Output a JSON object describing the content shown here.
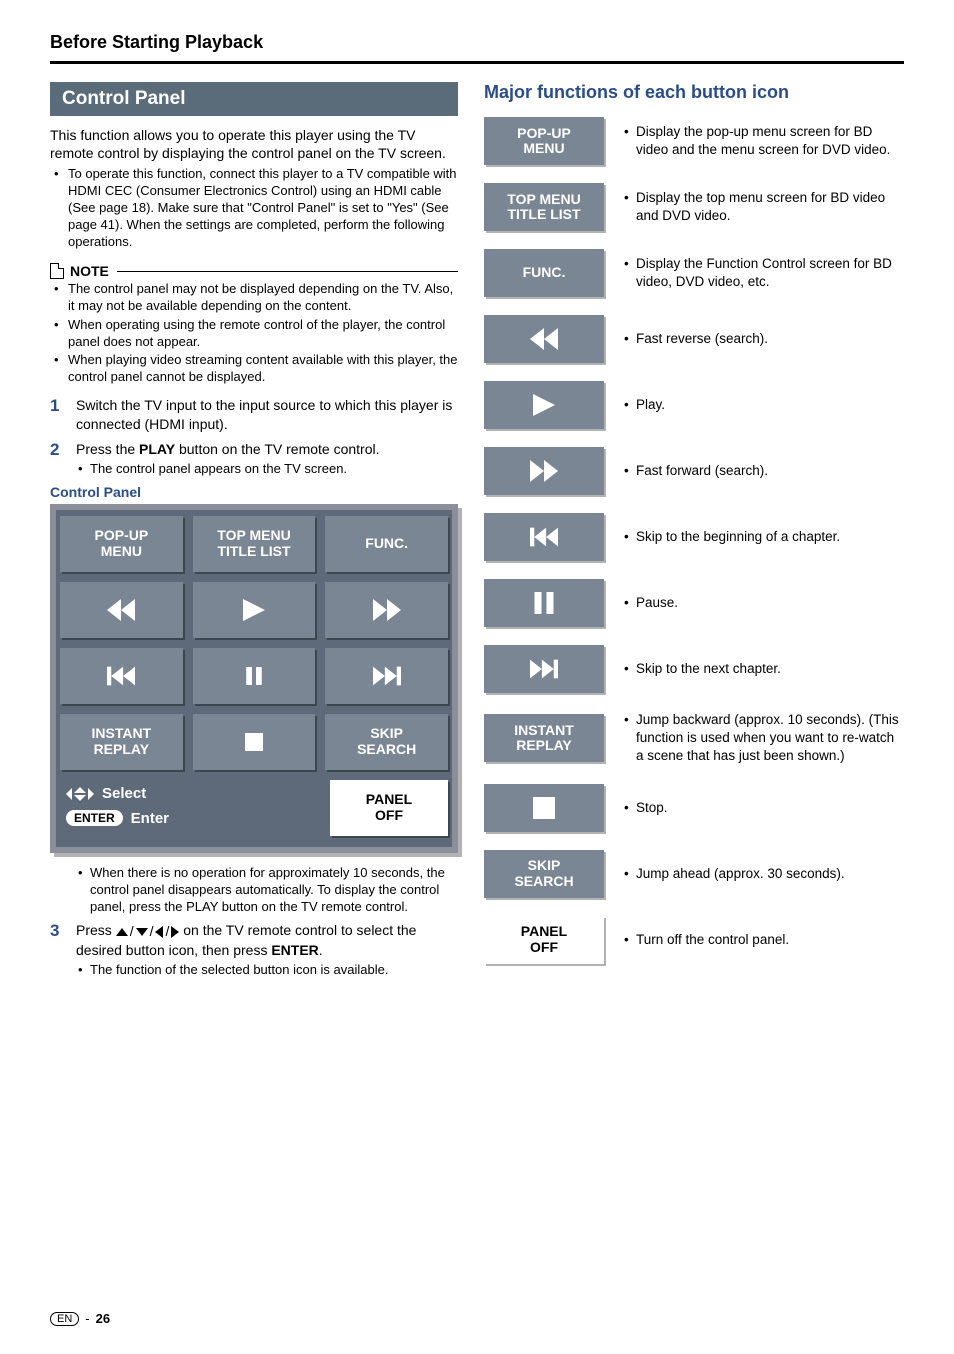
{
  "header": {
    "title": "Before Starting Playback"
  },
  "left": {
    "section_title": "Control Panel",
    "intro": "This function allows you to operate this player using the TV remote control by displaying the control panel on the TV screen.",
    "intro_bullets": [
      "To operate this function, connect this player to a TV compatible with HDMI CEC (Consumer Electronics Control) using an HDMI cable (See page 18). Make sure that \"Control Panel\" is set to \"Yes\" (See page 41). When the settings are completed, perform the following operations."
    ],
    "note_label": "NOTE",
    "note_bullets": [
      "The control panel may not be displayed depending on the TV. Also, it may not be available depending on the content.",
      "When operating using the remote control of the player, the control panel does not appear.",
      "When playing video streaming content available with this player, the control panel cannot be displayed."
    ],
    "steps": [
      {
        "num": "1",
        "body": "Switch the TV input to the input source to which this player is connected (HDMI input).",
        "sub": []
      },
      {
        "num": "2",
        "body_pre": "Press the ",
        "body_bold": "PLAY",
        "body_post": " button on the TV remote control.",
        "sub": [
          "The control panel appears on the TV screen."
        ]
      }
    ],
    "cp_caption": "Control Panel",
    "panel_labels": {
      "popup_a": "POP-UP",
      "popup_b": "MENU",
      "topmenu_a": "TOP MENU",
      "topmenu_b": "TITLE LIST",
      "func": "FUNC.",
      "instant_a": "INSTANT",
      "instant_b": "REPLAY",
      "skip_a": "SKIP",
      "skip_b": "SEARCH",
      "paneloff_a": "PANEL",
      "paneloff_b": "OFF",
      "select": "Select",
      "enter_badge": "ENTER",
      "enter": "Enter"
    },
    "after_panel_bullets": [
      "When there is no operation for approximately 10 seconds, the control panel disappears automatically. To display the control panel, press the PLAY button on the TV remote control."
    ],
    "step3": {
      "num": "3",
      "body_pre": "Press ",
      "body_mid": " on the TV remote control to select the desired button icon, then press ",
      "body_bold2": "ENTER",
      "body_end": ".",
      "sub": [
        "The function of the selected button icon is available."
      ]
    }
  },
  "right": {
    "title": "Major functions of each button icon",
    "items": [
      {
        "label_a": "POP-UP",
        "label_b": "MENU",
        "icon": "",
        "desc": "Display the pop-up menu screen for BD video and the menu screen for DVD video."
      },
      {
        "label_a": "TOP MENU",
        "label_b": "TITLE LIST",
        "icon": "",
        "desc": "Display the top menu screen for BD video and DVD video."
      },
      {
        "label_a": "FUNC.",
        "label_b": "",
        "icon": "",
        "desc": "Display the Function Control screen for BD video, DVD video, etc."
      },
      {
        "label_a": "",
        "label_b": "",
        "icon": "rew",
        "desc": "Fast reverse (search)."
      },
      {
        "label_a": "",
        "label_b": "",
        "icon": "play",
        "desc": "Play."
      },
      {
        "label_a": "",
        "label_b": "",
        "icon": "ffw",
        "desc": "Fast forward (search)."
      },
      {
        "label_a": "",
        "label_b": "",
        "icon": "prev",
        "desc": "Skip to the beginning of a chapter."
      },
      {
        "label_a": "",
        "label_b": "",
        "icon": "pause",
        "desc": "Pause."
      },
      {
        "label_a": "",
        "label_b": "",
        "icon": "next",
        "desc": "Skip to the next chapter."
      },
      {
        "label_a": "INSTANT",
        "label_b": "REPLAY",
        "icon": "",
        "desc": "Jump backward (approx. 10 seconds). (This function is used when you want to re-watch a scene that has just been shown.)"
      },
      {
        "label_a": "",
        "label_b": "",
        "icon": "stop",
        "desc": "Stop."
      },
      {
        "label_a": "SKIP",
        "label_b": "SEARCH",
        "icon": "",
        "desc": "Jump ahead (approx. 30 seconds)."
      },
      {
        "label_a": "PANEL",
        "label_b": "OFF",
        "icon": "",
        "white": true,
        "desc": "Turn off the control panel."
      }
    ]
  },
  "footer": {
    "lang": "EN",
    "sep": "-",
    "page": "26"
  }
}
